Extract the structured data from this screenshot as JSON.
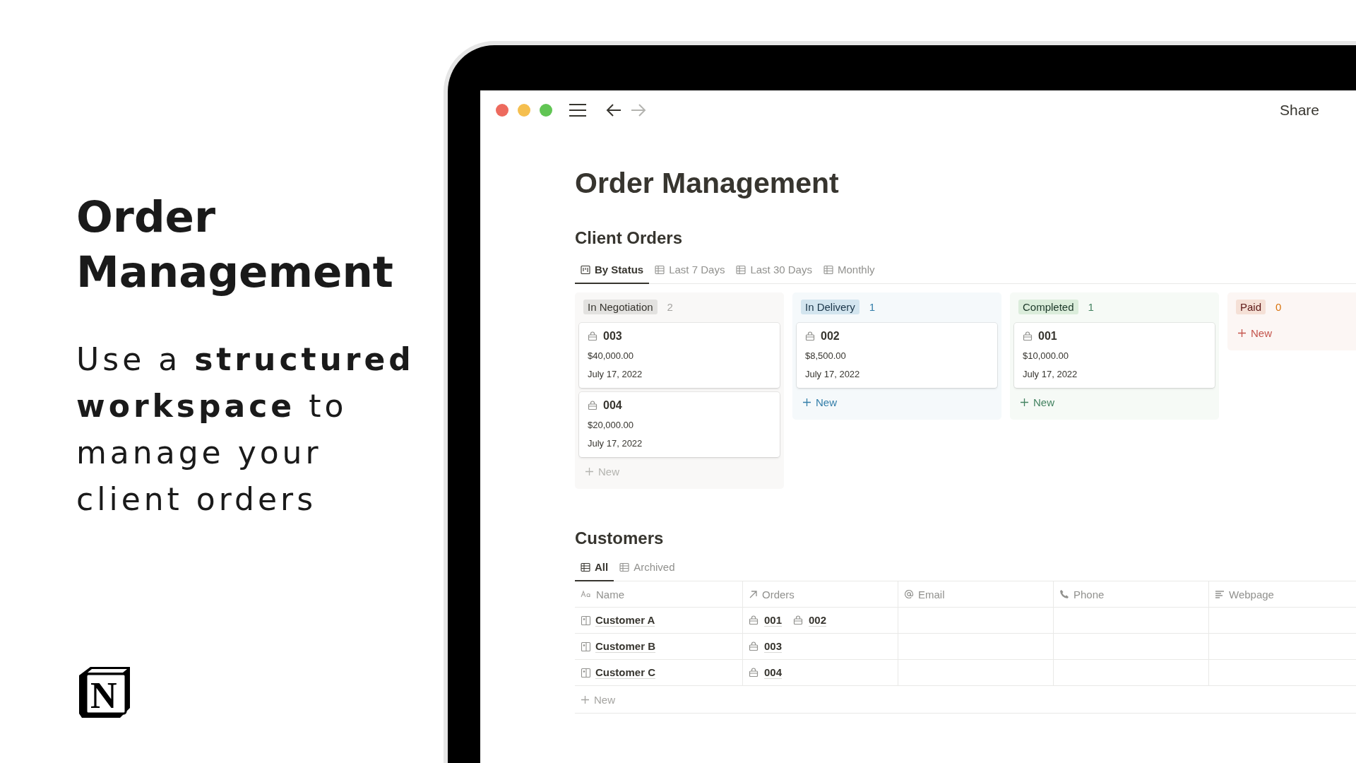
{
  "promo": {
    "title": "Order Management",
    "subtitle": "Use a **structured workspace** to manage your client orders",
    "logo": {
      "letter": "N"
    }
  },
  "window": {
    "share": "Share"
  },
  "page": {
    "title": "Order Management",
    "client_orders": {
      "heading": "Client Orders",
      "tabs": [
        {
          "label": "By Status",
          "kind": "board",
          "selected": true
        },
        {
          "label": "Last 7 Days",
          "kind": "table",
          "selected": false
        },
        {
          "label": "Last 30 Days",
          "kind": "table",
          "selected": false
        },
        {
          "label": "Monthly",
          "kind": "table",
          "selected": false
        }
      ],
      "columns": [
        {
          "status": "In Negotiation",
          "count": "2",
          "color": "#e3e2e0",
          "cards": [
            {
              "title": "003",
              "amount": "$40,000.00",
              "date": "July 17, 2022"
            },
            {
              "title": "004",
              "amount": "$20,000.00",
              "date": "July 17, 2022"
            }
          ],
          "new": "New"
        },
        {
          "status": "In Delivery",
          "count": "1",
          "color": "#d3e5ef",
          "cards": [
            {
              "title": "002",
              "amount": "$8,500.00",
              "date": "July 17, 2022"
            }
          ],
          "new": "New"
        },
        {
          "status": "Completed",
          "count": "1",
          "color": "#dbeddb",
          "cards": [
            {
              "title": "001",
              "amount": "$10,000.00",
              "date": "July 17, 2022"
            }
          ],
          "new": "New"
        },
        {
          "status": "Paid",
          "count": "0",
          "color": "#f5e0d6",
          "new": "New"
        }
      ]
    },
    "customers": {
      "heading": "Customers",
      "tabs": [
        {
          "label": "All",
          "selected": true
        },
        {
          "label": "Archived",
          "selected": false
        }
      ],
      "columns": [
        {
          "label": "Name",
          "kind": "text"
        },
        {
          "label": "Orders",
          "kind": "relation"
        },
        {
          "label": "Email",
          "kind": "email"
        },
        {
          "label": "Phone",
          "kind": "phone"
        },
        {
          "label": "Webpage",
          "kind": "url"
        }
      ],
      "rows": [
        {
          "name": "Customer A",
          "orders": [
            "001",
            "002"
          ]
        },
        {
          "name": "Customer B",
          "orders": [
            "003"
          ]
        },
        {
          "name": "Customer C",
          "orders": [
            "004"
          ]
        }
      ],
      "new": "New"
    }
  }
}
